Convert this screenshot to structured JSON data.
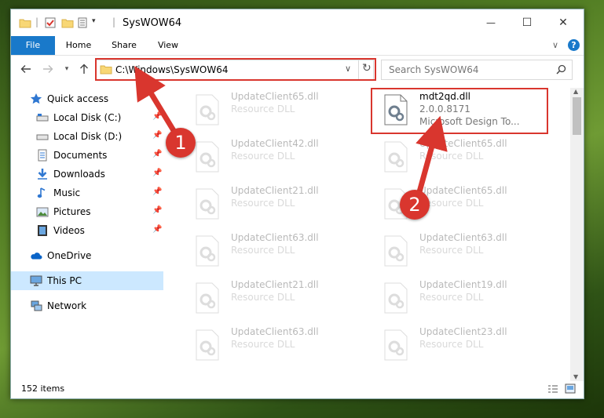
{
  "window": {
    "title": "SysWOW64",
    "controls": {
      "minimize": "—",
      "maximize": "☐",
      "close": "✕"
    }
  },
  "ribbon": {
    "tabs": [
      "File",
      "Home",
      "Share",
      "View"
    ],
    "chevron": "∨",
    "help": "?"
  },
  "address": {
    "path": "C:\\Windows\\SysWOW64",
    "refresh_icon": "↻",
    "dropdown_icon": "∨"
  },
  "search": {
    "placeholder": "Search SysWOW64"
  },
  "nav": {
    "quick_access": "Quick access",
    "items": [
      {
        "label": "Local Disk (C:)",
        "icon": "drive-icon"
      },
      {
        "label": "Local Disk (D:)",
        "icon": "drive-icon"
      },
      {
        "label": "Documents",
        "icon": "documents-icon"
      },
      {
        "label": "Downloads",
        "icon": "downloads-icon"
      },
      {
        "label": "Music",
        "icon": "music-icon"
      },
      {
        "label": "Pictures",
        "icon": "pictures-icon"
      },
      {
        "label": "Videos",
        "icon": "videos-icon"
      }
    ],
    "onedrive": "OneDrive",
    "this_pc": "This PC",
    "network": "Network"
  },
  "files": {
    "highlighted": {
      "name": "mdt2qd.dll",
      "version": "2.0.0.8171",
      "desc": "Microsoft Design To..."
    },
    "left_column": [
      {
        "name": "UpdateClient65.dll",
        "type": "Resource DLL"
      },
      {
        "name": "UpdateClient42.dll",
        "type": "Resource DLL"
      },
      {
        "name": "UpdateClient21.dll",
        "type": "Resource DLL"
      },
      {
        "name": "UpdateClient63.dll",
        "type": "Resource DLL"
      },
      {
        "name": "UpdateClient21.dll",
        "type": "Resource DLL"
      },
      {
        "name": "UpdateClient63.dll",
        "type": "Resource DLL"
      }
    ],
    "right_column": [
      {
        "name": "UpdateClient65.dll",
        "type": "Resource DLL"
      },
      {
        "name": "UpdateClient65.dll",
        "type": "Resource DLL"
      },
      {
        "name": "UpdateClient63.dll",
        "type": "Resource DLL"
      },
      {
        "name": "UpdateClient19.dll",
        "type": "Resource DLL"
      },
      {
        "name": "UpdateClient23.dll",
        "type": "Resource DLL"
      }
    ]
  },
  "status": {
    "count": "152 items"
  },
  "callouts": {
    "one": "1",
    "two": "2"
  },
  "colors": {
    "accent": "#1979ca",
    "highlight": "#d9362e",
    "selected": "#cce8ff"
  }
}
